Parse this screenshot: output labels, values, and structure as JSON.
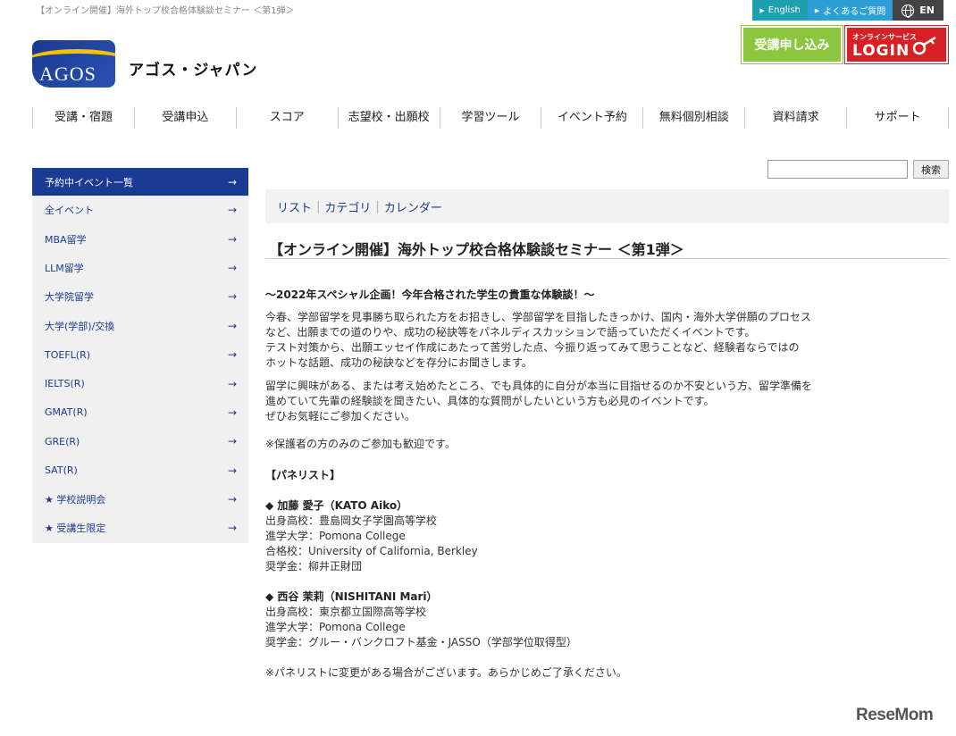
{
  "page": {
    "title_text": "【オンライン開催】海外トップ校合格体験談セミナー ＜第1弾＞"
  },
  "utility": {
    "english": "English",
    "faq": "よくあるご質問",
    "lang": "EN"
  },
  "brand": {
    "logo_text": "AGOS",
    "name": "アゴス・ジャパン"
  },
  "header_buttons": {
    "apply": "受講申し込み",
    "login_small": "オンラインサービス",
    "login_big": "LOGIN"
  },
  "nav": [
    {
      "label": "受講・宿題"
    },
    {
      "label": "受講申込"
    },
    {
      "label": "スコア"
    },
    {
      "label": "志望校・出願校"
    },
    {
      "label": "学習ツール"
    },
    {
      "label": "イベント予約"
    },
    {
      "label": "無料個別相談"
    },
    {
      "label": "資料請求"
    },
    {
      "label": "サポート"
    }
  ],
  "search": {
    "placeholder": "",
    "button": "検索"
  },
  "sidebar": [
    {
      "label": "予約中イベント一覧"
    },
    {
      "label": "全イベント"
    },
    {
      "label": "MBA留学"
    },
    {
      "label": "LLM留学"
    },
    {
      "label": "大学院留学"
    },
    {
      "label": "大学(学部)/交換"
    },
    {
      "label": "TOEFL(R)"
    },
    {
      "label": "IELTS(R)"
    },
    {
      "label": "GMAT(R)"
    },
    {
      "label": "GRE(R)"
    },
    {
      "label": "SAT(R)"
    },
    {
      "label": "★ 学校説明会"
    },
    {
      "label": "★ 受講生限定"
    }
  ],
  "tabs": [
    {
      "label": "リスト"
    },
    {
      "label": "カテゴリ"
    },
    {
      "label": "カレンダー"
    }
  ],
  "event": {
    "title": "【オンライン開催】海外トップ校合格体験談セミナー ＜第1弾＞",
    "lead": "～2022年スペシャル企画！今年合格された学生の貴重な体験談！～",
    "para1_lines": [
      "今春、学部留学を見事勝ち取られた方をお招きし、学部留学を目指したきっかけ、国内・海外大学併願のプロセス",
      "など、出願までの道のりや、成功の秘訣等をパネルディスカッションで語っていただくイベントです。",
      "テスト対策から、出願エッセイ作成にあたって苦労した点、今振り返ってみて思うことなど、経験者ならではの",
      "ホットな話題、成功の秘訣などを存分にお聞きします。"
    ],
    "para2_lines": [
      "留学に興味がある、または考え始めたところ、でも具体的に自分が本当に目指せるのか不安という方、留学準備を",
      "進めていて先輩の経験談を聞きたい、具体的な質問がしたいという方も必見のイベントです。",
      "ぜひお気軽にご参加ください。"
    ],
    "note_parents": "※保護者の方のみのご参加も歓迎です。",
    "panelist_heading": "【パネリスト】",
    "panelist1_name": "◆ 加藤 愛子（KATO Aiko）",
    "panelist1_lines": [
      "出身高校：豊島岡女子学園高等学校",
      "進学大学：Pomona College",
      "合格校：University of California, Berkley",
      "奨学金：柳井正財団"
    ],
    "panelist2_name": "◆ 西谷 茉莉（NISHITANI Mari）",
    "panelist2_lines": [
      "出身高校：東京都立国際高等学校",
      "進学大学：Pomona College",
      "奨学金：グルー・バンクロフト基金・JASSO（学部学位取得型）"
    ],
    "note_change": "※パネリストに変更がある場合がございます。あらかじめご了承ください。"
  },
  "watermark": {
    "text_a": "Rese",
    "text_b": "Mom"
  },
  "colors": {
    "nav_blue": "#1b3a94",
    "apply_green": "#8cc63f",
    "login_red": "#d71f26"
  }
}
